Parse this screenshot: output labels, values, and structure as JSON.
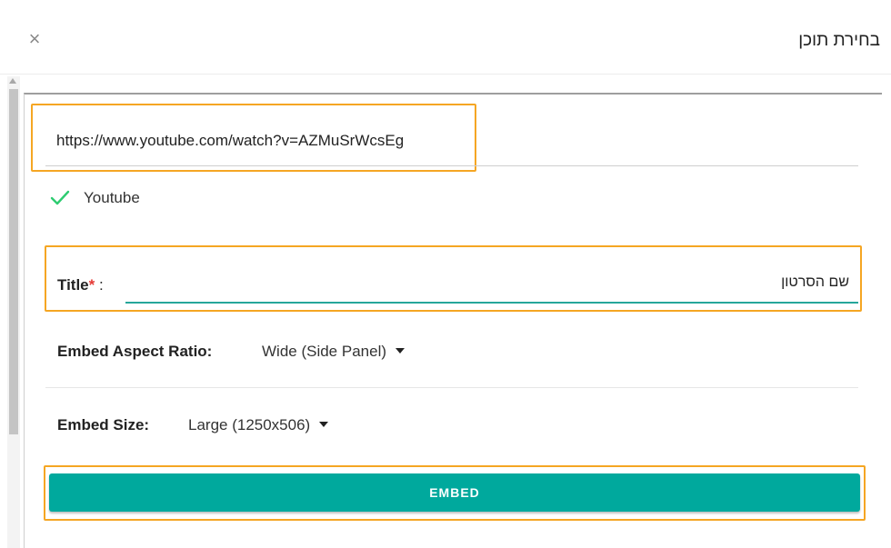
{
  "dialog": {
    "title": "בחירת תוכן",
    "close_label": "×"
  },
  "url_field": {
    "value": "https://www.youtube.com/watch?v=AZMuSrWcsEg"
  },
  "provider": {
    "name": "Youtube",
    "status_icon": "check-icon",
    "status_color": "#2ecc71"
  },
  "title_field": {
    "label": "Title",
    "required_mark": "*",
    "separator": " :",
    "value": "שם הסרטון"
  },
  "aspect_ratio": {
    "label": "Embed Aspect Ratio:",
    "selected": "Wide (Side Panel)"
  },
  "embed_size": {
    "label": "Embed Size:",
    "selected": "Large (1250x506)"
  },
  "embed_button": {
    "label": "EMBED"
  },
  "colors": {
    "accent": "#00a99d",
    "highlight": "#f5a623",
    "required": "#e53935"
  }
}
